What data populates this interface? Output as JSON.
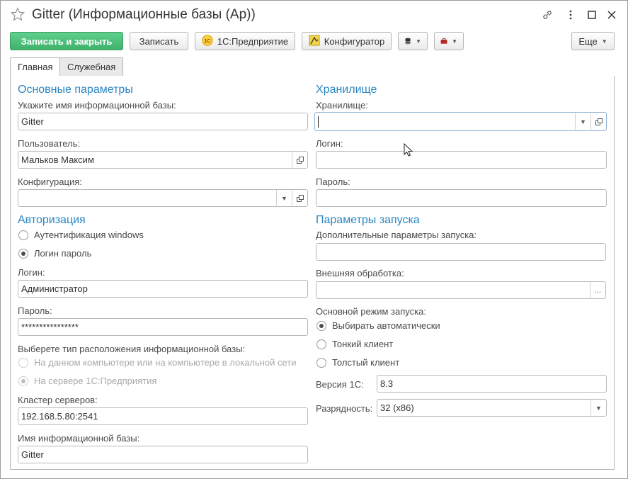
{
  "window": {
    "title": "Gitter (Информационные базы (Ap))"
  },
  "toolbar": {
    "save_close": "Записать и закрыть",
    "save": "Записать",
    "enterprise": "1С:Предприятие",
    "configurator": "Конфигуратор",
    "more": "Еще"
  },
  "tabs": [
    {
      "label": "Главная",
      "active": true
    },
    {
      "label": "Служебная",
      "active": false
    }
  ],
  "left": {
    "basic_params_title": "Основные параметры",
    "ib_name_label": "Укажите имя информационной базы:",
    "ib_name_value": "Gitter",
    "user_label": "Пользователь:",
    "user_value": "Мальков Максим",
    "config_label": "Конфигурация:",
    "config_value": "",
    "auth_title": "Авторизация",
    "auth_windows": "Аутентификация windows",
    "auth_login": "Логин пароль",
    "auth_selected": "Логин пароль",
    "login_label": "Логин:",
    "login_value": "Администратор",
    "password_label": "Пароль:",
    "password_value": "****************",
    "location_label": "Выберете тип расположения информационной базы:",
    "location_local": "На данном компьютере или на компьютере в локальной сети",
    "location_server": "На сервере 1С:Предприятия",
    "location_selected": "На сервере 1С:Предприятия",
    "cluster_label": "Кластер серверов:",
    "cluster_value": "192.168.5.80:2541",
    "ib_name2_label": "Имя информационной базы:",
    "ib_name2_value": "Gitter"
  },
  "right": {
    "storage_title": "Хранилище",
    "storage_label": "Хранилище:",
    "storage_value": "",
    "login_label": "Логин:",
    "login_value": "",
    "password_label": "Пароль:",
    "password_value": "",
    "launch_title": "Параметры запуска",
    "extra_params_label": "Дополнительные параметры запуска:",
    "extra_params_value": "",
    "ext_processing_label": "Внешняя обработка:",
    "ext_processing_value": "",
    "ext_processing_btn": "...",
    "mode_label": "Основной режим запуска:",
    "mode_auto": "Выбирать автоматически",
    "mode_thin": "Тонкий клиент",
    "mode_thick": "Толстый клиент",
    "mode_selected": "Выбирать автоматически",
    "version_label": "Версия 1С:",
    "version_value": "8.3",
    "bitness_label": "Разрядность:",
    "bitness_value": "32 (x86)"
  },
  "colors": {
    "primary_button": "#3fb26c",
    "section_title": "#2a86c3"
  }
}
